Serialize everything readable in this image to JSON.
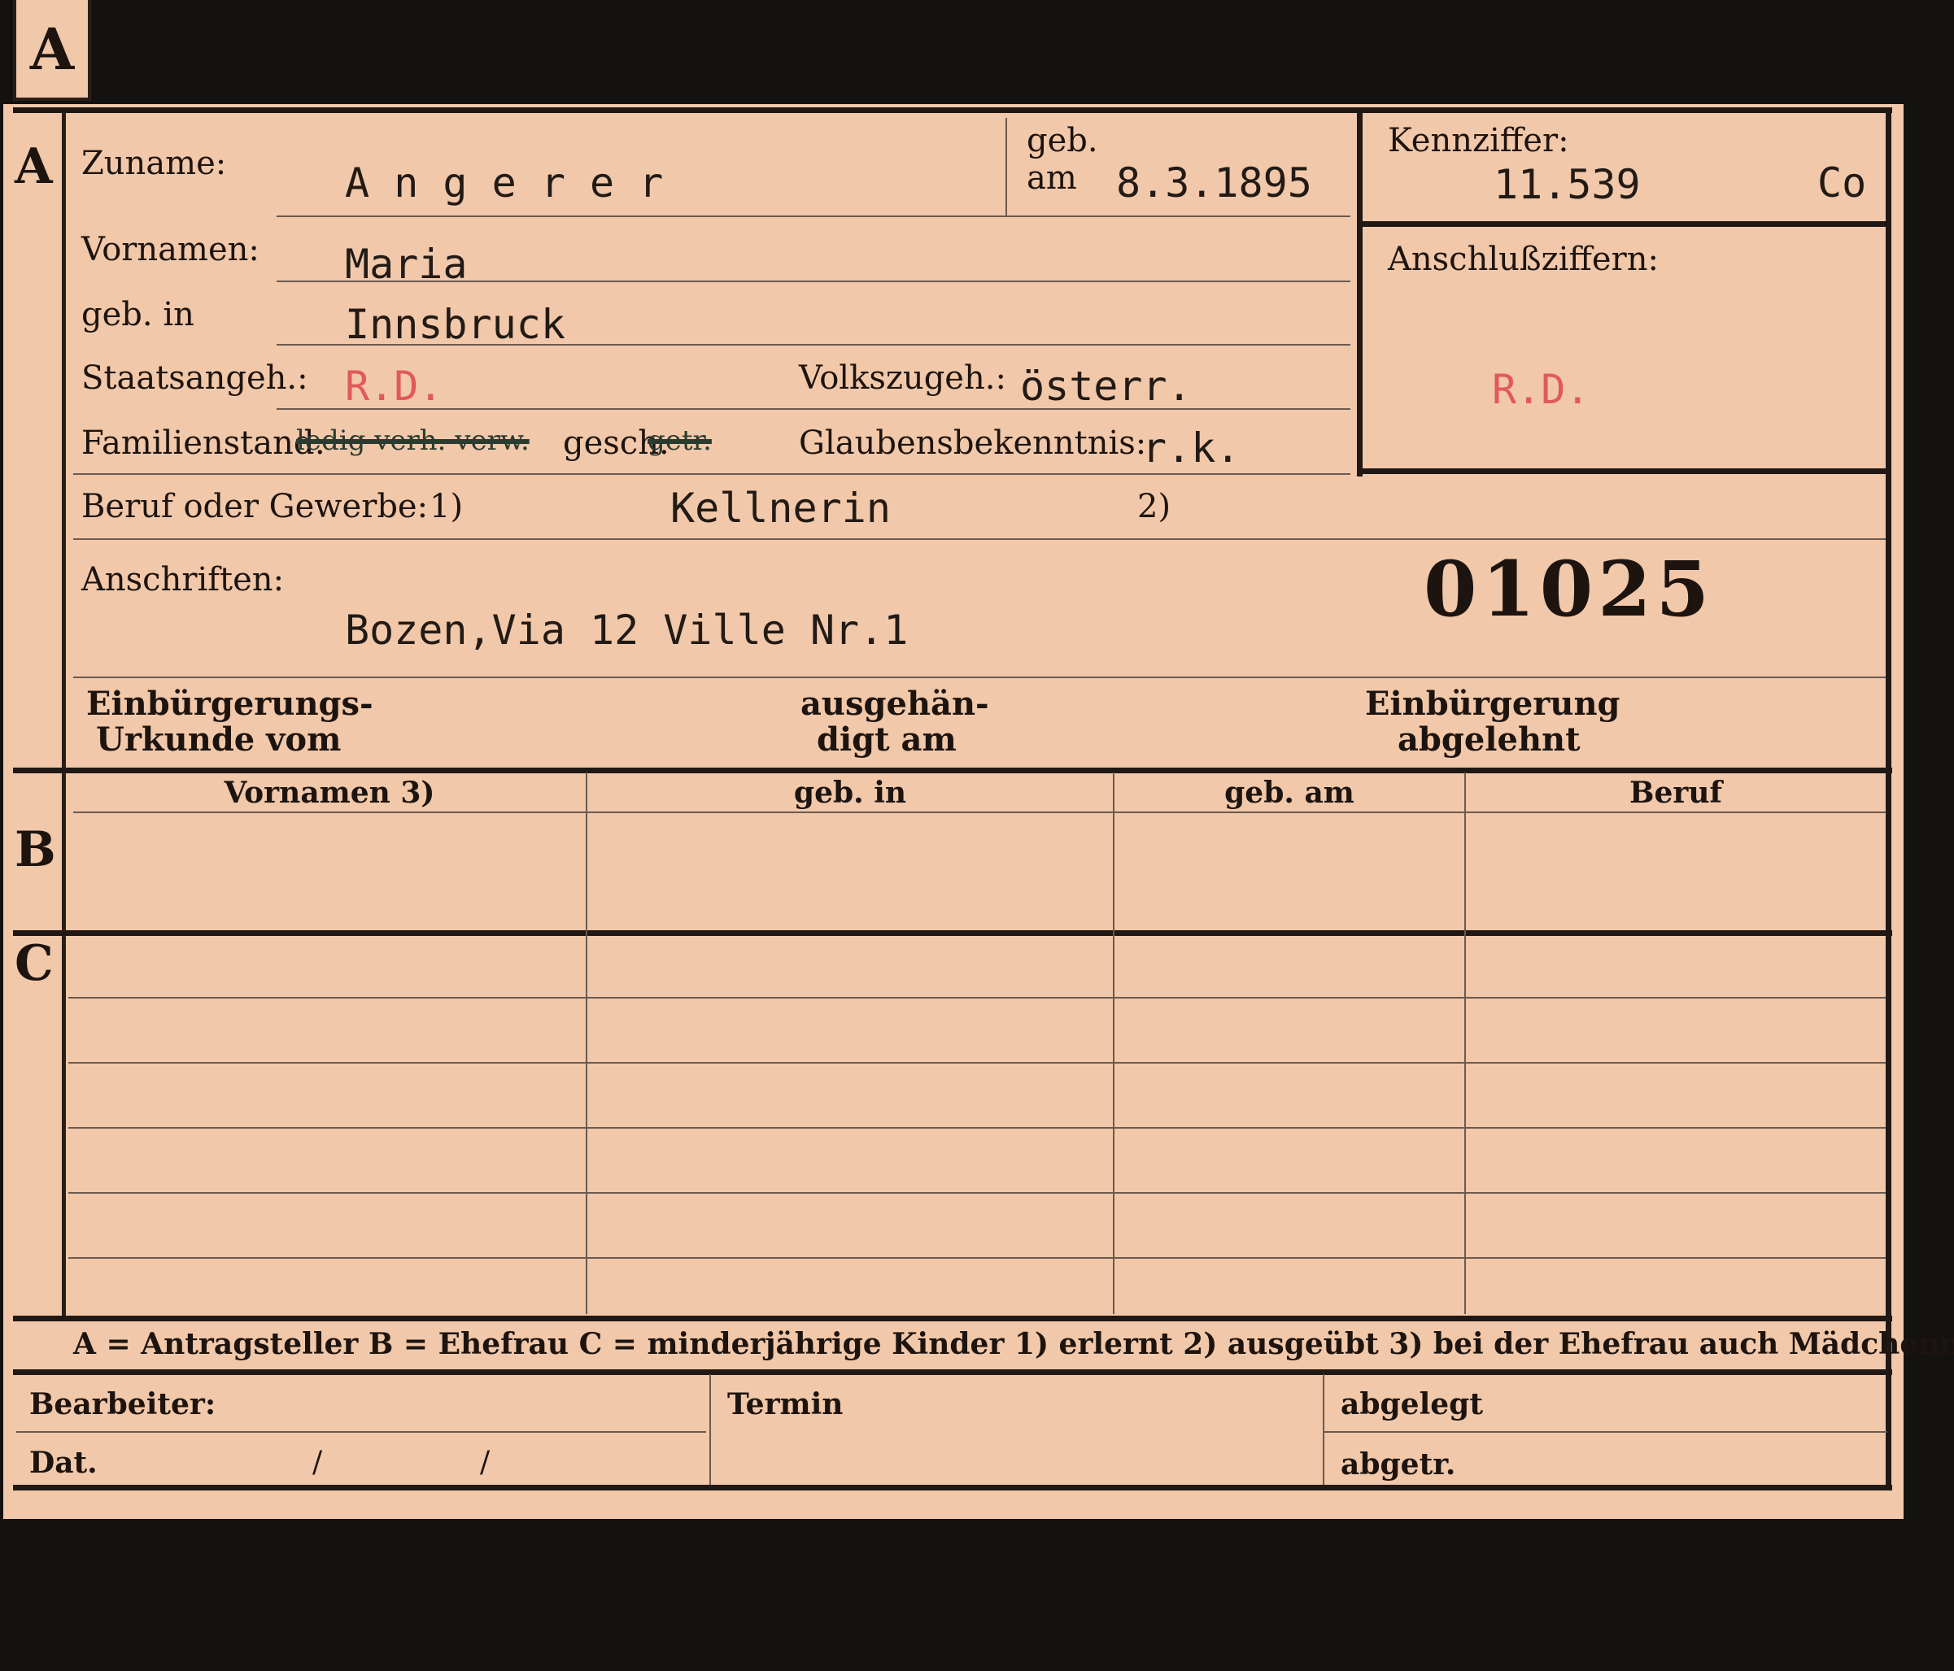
{
  "tab_letter": "A",
  "section_labels": {
    "a": "A",
    "b": "B",
    "c": "C"
  },
  "form": {
    "zuname_label": "Zuname:",
    "zuname": "A n g e r e r",
    "geb_am_label_1": "geb.",
    "geb_am_label_2": "am",
    "geb_am": "8.3.1895",
    "kennziffer_label": "Kennziffer:",
    "kennziffer": "11.539",
    "kennziffer_suffix": "Co",
    "anschluss_label": "Anschlußziffern:",
    "anschluss_value": "R.D.",
    "vornamen_label": "Vornamen:",
    "vornamen": "Maria",
    "geb_in_label": "geb. in",
    "geb_in": "Innsbruck",
    "staatsangeh_label": "Staatsangeh.:",
    "staatsangeh": "R.D.",
    "volkszugeh_label": "Volkszugeh.:",
    "volkszugeh": "österr.",
    "familienstand_label": "Familienstand:",
    "familienstand_struck": "ledig verh. verw.",
    "familienstand_gesch": "gesch.",
    "familienstand_struck2": "getr.",
    "glaubens_label": "Glaubensbekenntnis:",
    "glaubens": "r.k.",
    "beruf_label": "Beruf oder Gewerbe:",
    "beruf_note1": "1)",
    "beruf": "Kellnerin",
    "beruf_note2": "2)",
    "anschriften_label": "Anschriften:",
    "anschrift": "Bozen,Via 12 Ville Nr.1",
    "stamp_number": "01025",
    "einb_urkunde_1": "Einbürgerungs-",
    "einb_urkunde_2": "Urkunde vom",
    "ausgehaend_1": "ausgehän-",
    "ausgehaend_2": "digt am",
    "einb_abgelehnt_1": "Einbürgerung",
    "einb_abgelehnt_2": "abgelehnt"
  },
  "table": {
    "headers": [
      "Vornamen 3)",
      "geb. in",
      "geb. am",
      "Beruf"
    ]
  },
  "legend": "A = Antragsteller   B = Ehefrau   C = minderjährige Kinder   1) erlernt   2) ausgeübt   3) bei der Ehefrau auch Mädchenname",
  "footer": {
    "bearbeiter": "Bearbeiter:",
    "termin": "Termin",
    "abgelegt": "abgelegt",
    "dat": "Dat.",
    "slash1": "/",
    "slash2": "/",
    "abgetr": "abgetr."
  }
}
